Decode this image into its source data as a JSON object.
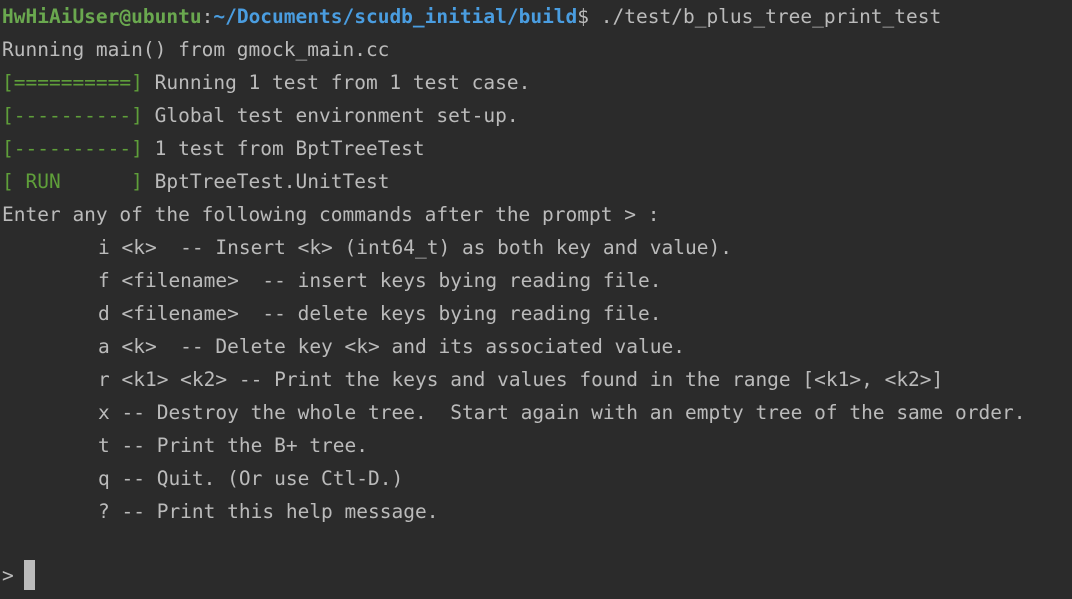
{
  "prompt": {
    "user_host": "HwHiAiUser@ubuntu",
    "colon": ":",
    "path": "~/Documents/scudb_initial/build",
    "sigil": "$",
    "command": " ./test/b_plus_tree_print_test"
  },
  "output": {
    "running_main": "Running main() from gmock_main.cc",
    "tag_eq": "[==========]",
    "running_tests": " Running 1 test from 1 test case.",
    "tag_dash1": "[----------]",
    "global_env": " Global test environment set-up.",
    "tag_dash2": "[----------]",
    "tests_from": " 1 test from BptTreeTest",
    "tag_run": "[ RUN      ]",
    "unit_test": " BptTreeTest.UnitTest",
    "enter_commands": "Enter any of the following commands after the prompt > :"
  },
  "help_lines": [
    "i <k>  -- Insert <k> (int64_t) as both key and value).",
    "f <filename>  -- insert keys bying reading file.",
    "d <filename>  -- delete keys bying reading file.",
    "a <k>  -- Delete key <k> and its associated value.",
    "r <k1> <k2> -- Print the keys and values found in the range [<k1>, <k2>]",
    "x -- Destroy the whole tree.  Start again with an empty tree of the same order.",
    "t -- Print the B+ tree.",
    "q -- Quit. (Or use Ctl-D.)",
    "? -- Print this help message."
  ],
  "input_prompt": ">",
  "colors": {
    "background": "#2b2b2b",
    "text": "#bbbbbb",
    "user": "#6aa84f",
    "path": "#4a9de0",
    "gtest_tag": "#5f9f3a"
  }
}
